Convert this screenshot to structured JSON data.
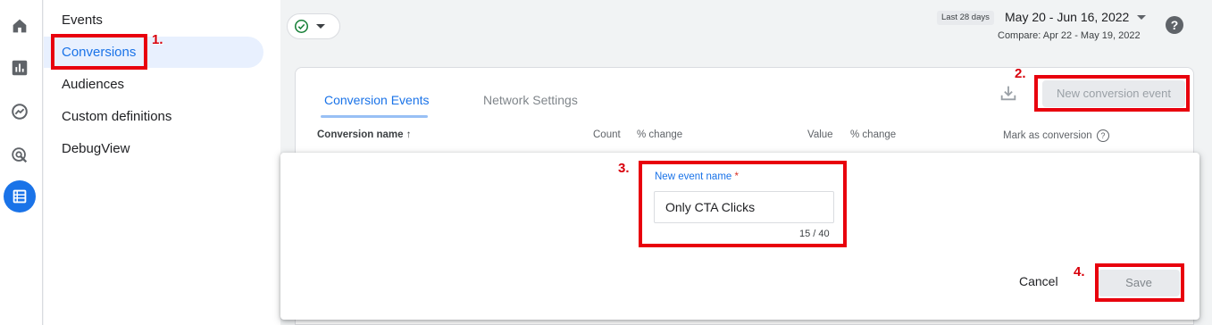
{
  "rail": {
    "icons": [
      "home-icon",
      "reports-icon",
      "explore-icon",
      "advertising-icon",
      "configure-icon"
    ]
  },
  "nav": {
    "items": [
      "Events",
      "Conversions",
      "Audiences",
      "Custom definitions",
      "DebugView"
    ],
    "active": "Conversions"
  },
  "topbar": {
    "date_badge": "Last 28 days",
    "date_range": "May 20 - Jun 16, 2022",
    "compare": "Compare: Apr 22 - May 19, 2022",
    "help": "?"
  },
  "card": {
    "tabs": [
      "Conversion Events",
      "Network Settings"
    ],
    "active_tab": "Conversion Events",
    "new_conversion_button": "New conversion event",
    "columns": {
      "name": "Conversion name ↑",
      "count": "Count",
      "count_change": "% change",
      "value": "Value",
      "value_change": "% change",
      "mark": "Mark as conversion",
      "mark_info": "?"
    }
  },
  "dialog": {
    "field_label": "New event name",
    "required_mark": "*",
    "field_value": "Only CTA Clicks",
    "counter": "15 / 40",
    "cancel": "Cancel",
    "save": "Save"
  },
  "annotations": {
    "steps": [
      "1.",
      "2.",
      "3.",
      "4."
    ],
    "color": "#e8000d"
  },
  "colors": {
    "accent": "#1a73e8",
    "active_nav_bg": "#e8f0fe",
    "success": "#188038"
  }
}
